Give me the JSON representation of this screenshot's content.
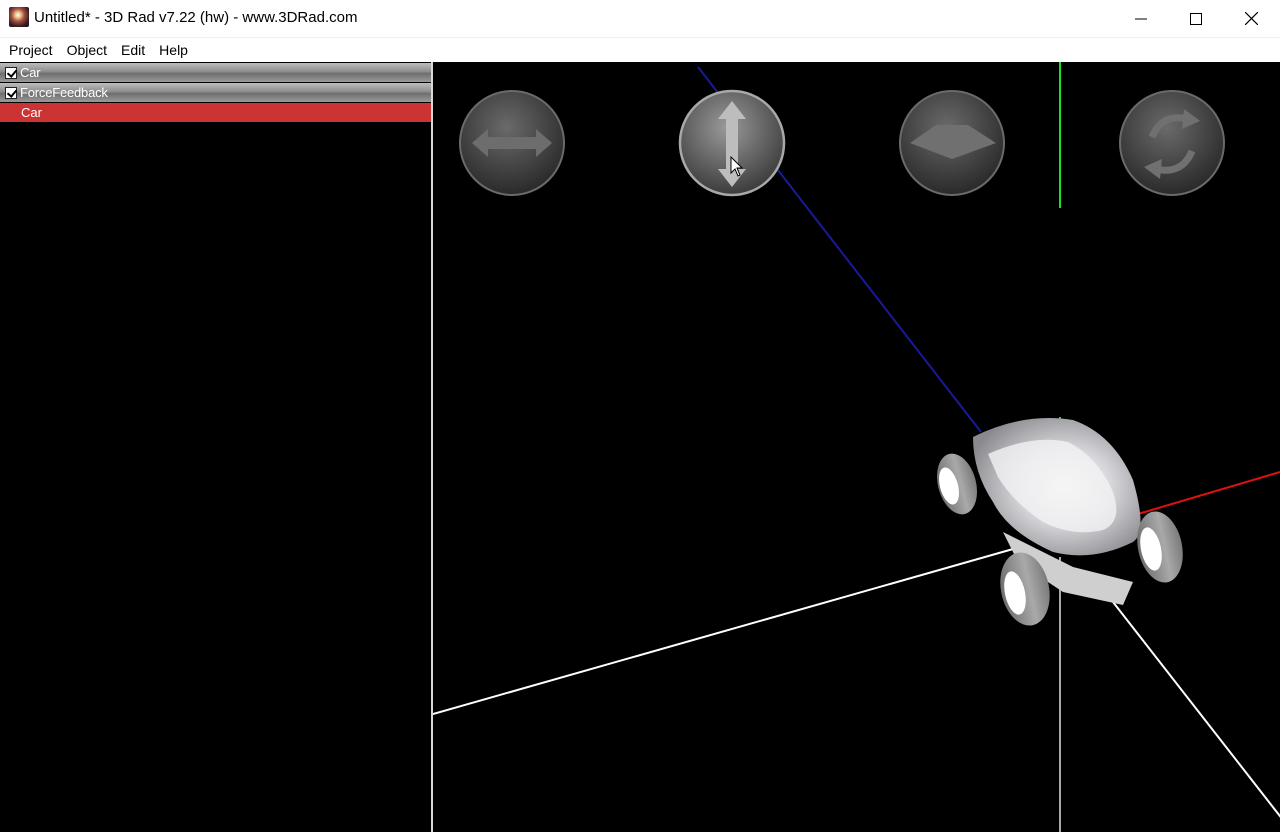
{
  "window": {
    "title": "Untitled* - 3D Rad v7.22 (hw) - www.3DRad.com",
    "minimize_icon": "minimize-icon",
    "maximize_icon": "maximize-icon",
    "close_icon": "close-icon"
  },
  "menu": {
    "items": [
      "Project",
      "Object",
      "Edit",
      "Help"
    ]
  },
  "object_list": {
    "items": [
      {
        "label": "Car",
        "checked": true
      },
      {
        "label": "ForceFeedback",
        "checked": true
      }
    ],
    "selected": {
      "label": "Car"
    },
    "selection_color": "#cc3333"
  },
  "viewport": {
    "tools": [
      {
        "name": "move-horizontal-tool",
        "icon": "horizontal-arrows-icon"
      },
      {
        "name": "move-vertical-tool",
        "icon": "vertical-arrows-icon",
        "active": true
      },
      {
        "name": "move-plane-tool",
        "icon": "plane-icon"
      },
      {
        "name": "rotate-tool",
        "icon": "rotate-arrows-icon"
      }
    ],
    "axis_colors": {
      "x": "#dd1111",
      "y": "#22dd22",
      "z": "#1a1a99",
      "grid": "#ffffff"
    },
    "model": "Car"
  }
}
